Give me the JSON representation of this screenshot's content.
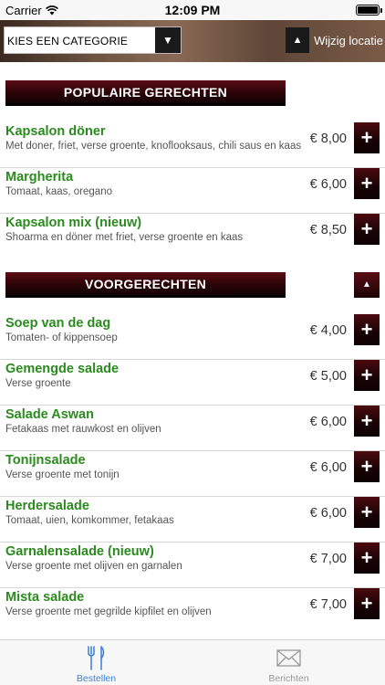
{
  "status_bar": {
    "carrier": "Carrier",
    "time": "12:09 PM"
  },
  "header": {
    "category_select": {
      "placeholder": "KIES EEN CATEGORIE"
    },
    "location_button": "Wijzig locatie"
  },
  "sections": [
    {
      "title": "POPULAIRE GERECHTEN",
      "dishes": [
        {
          "name": "Kapsalon döner",
          "description": "Met doner, friet, verse groente, knoflooksaus, chili saus en kaas",
          "price": "€ 8,00"
        },
        {
          "name": "Margherita",
          "description": "Tomaat, kaas, oregano",
          "price": "€ 6,00"
        },
        {
          "name": "Kapsalon mix (nieuw)",
          "description": "Shoarma en döner met friet, verse groente en kaas",
          "price": "€ 8,50"
        }
      ]
    },
    {
      "title": "VOORGERECHTEN",
      "dishes": [
        {
          "name": "Soep van de dag",
          "description": "Tomaten- of kippensoep",
          "price": "€ 4,00"
        },
        {
          "name": "Gemengde salade",
          "description": "Verse groente",
          "price": "€ 5,00"
        },
        {
          "name": "Salade Aswan",
          "description": "Fetakaas met rauwkost en olijven",
          "price": "€ 6,00"
        },
        {
          "name": "Tonijnsalade",
          "description": "Verse groente met tonijn",
          "price": "€ 6,00"
        },
        {
          "name": "Herdersalade",
          "description": "Tomaat, uien, komkommer, fetakaas",
          "price": "€ 6,00"
        },
        {
          "name": "Garnalensalade (nieuw)",
          "description": "Verse groente met olijven en garnalen",
          "price": "€ 7,00"
        },
        {
          "name": "Mista salade",
          "description": "Verse groente met gegrilde kipfilet en olijven",
          "price": "€ 7,00"
        }
      ]
    }
  ],
  "tabbar": {
    "tabs": [
      {
        "label": "Bestellen",
        "icon": "cutlery-icon",
        "active": true
      },
      {
        "label": "Berichten",
        "icon": "envelope-icon",
        "active": false
      }
    ]
  },
  "colors": {
    "accent": "#3a7fd6",
    "dish_name": "#2b8a1e",
    "header_dark_red": "#5a0d14"
  }
}
